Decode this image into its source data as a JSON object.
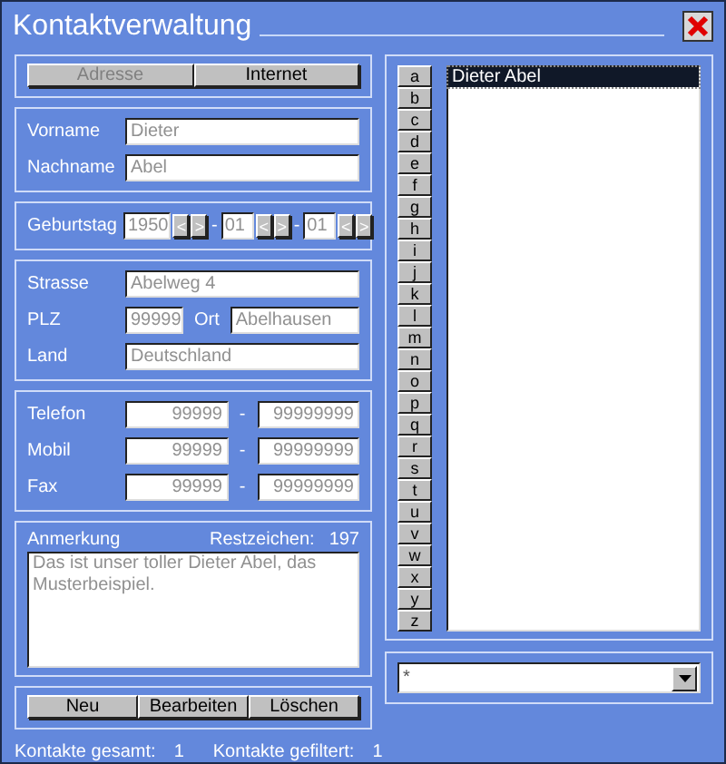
{
  "window": {
    "title": "Kontaktverwaltung"
  },
  "tabs": [
    {
      "label": "Adresse",
      "selected": true
    },
    {
      "label": "Internet",
      "selected": false
    }
  ],
  "name": {
    "fields": [
      {
        "label": "Vorname",
        "value": "Dieter"
      },
      {
        "label": "Nachname",
        "value": "Abel"
      }
    ]
  },
  "birthday": {
    "label": "Geburtstag",
    "parts": [
      {
        "value": "1950",
        "prev": "<",
        "next": ">"
      },
      {
        "value": "01",
        "prev": "<",
        "next": ">"
      },
      {
        "value": "01",
        "prev": "<",
        "next": ">"
      }
    ],
    "separator": "-"
  },
  "address": {
    "street": {
      "label": "Strasse",
      "value": "Abelweg 4"
    },
    "zip": {
      "label": "PLZ",
      "value": "99999"
    },
    "city": {
      "label": "Ort",
      "value": "Abelhausen"
    },
    "country": {
      "label": "Land",
      "value": "Deutschland"
    }
  },
  "phones": [
    {
      "label": "Telefon",
      "area": "99999",
      "separator": "-",
      "number": "99999999"
    },
    {
      "label": "Mobil",
      "area": "99999",
      "separator": "-",
      "number": "99999999"
    },
    {
      "label": "Fax",
      "area": "99999",
      "separator": "-",
      "number": "99999999"
    }
  ],
  "note": {
    "label": "Anmerkung",
    "remaining_label": "Restzeichen:",
    "remaining": "197",
    "value": "Das ist unser toller Dieter Abel, das Musterbeispiel."
  },
  "buttons": [
    "Neu",
    "Bearbeiten",
    "Löschen"
  ],
  "status_bar": {
    "total_label": "Kontakte gesamt:",
    "total": "1",
    "filtered_label": "Kontakte gefiltert:",
    "filtered": "1"
  },
  "letters": [
    "a",
    "b",
    "c",
    "d",
    "e",
    "f",
    "g",
    "h",
    "i",
    "j",
    "k",
    "l",
    "m",
    "n",
    "o",
    "p",
    "q",
    "r",
    "s",
    "t",
    "u",
    "v",
    "w",
    "x",
    "y",
    "z"
  ],
  "contacts": [
    {
      "text": "Dieter Abel",
      "selected": true
    }
  ],
  "filter": {
    "value": "*"
  }
}
